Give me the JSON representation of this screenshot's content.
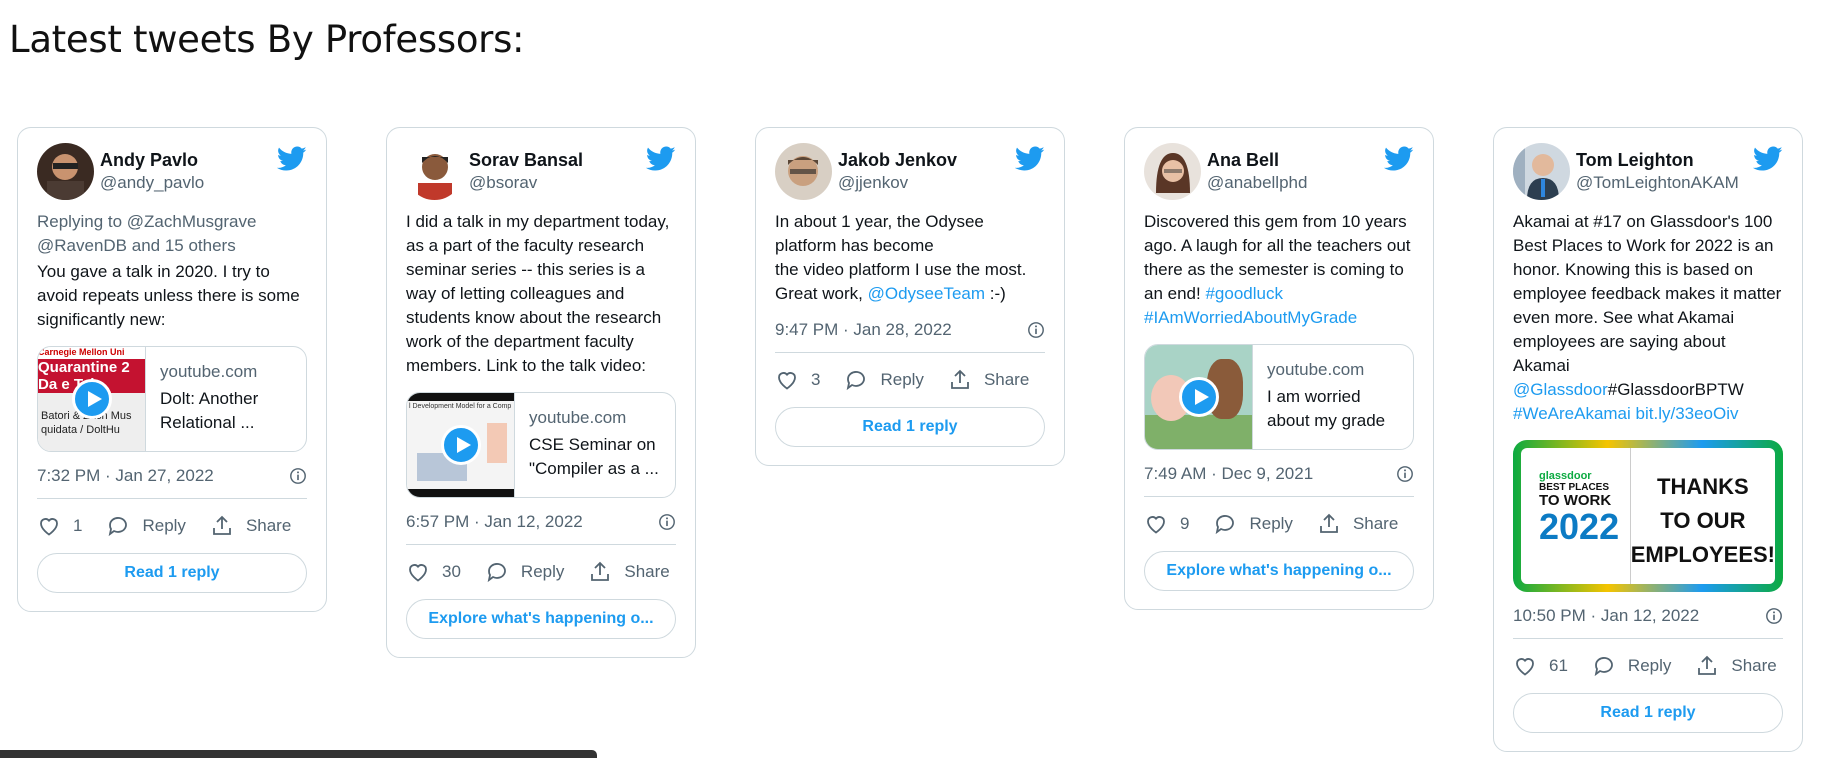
{
  "page": {
    "title": "Latest tweets By Professors:"
  },
  "tweets": [
    {
      "name": "Andy Pavlo",
      "handle": "@andy_pavlo",
      "reply_to": "Replying to @ZachMusgrave\n@RavenDB and 15 others",
      "text": "You gave a talk in 2020. I try to avoid repeats unless there is some significantly new:",
      "card": {
        "domain": "youtube.com",
        "title": "Dolt: Another\nRelational ...",
        "thumb_text": [
          "Carnegie Mellon Uni",
          "Quarantine 2",
          "Da  e Tal",
          "Batori & Zach Mus",
          "quidata / DoltHu"
        ]
      },
      "timestamp": "7:32 PM · Jan 27, 2022",
      "likes": "1",
      "reply_label": "Reply",
      "share_label": "Share",
      "button": "Read 1 reply"
    },
    {
      "name": "Sorav Bansal",
      "handle": "@bsorav",
      "text": "I did a talk in my department today, as a part of the faculty research seminar series -- this series is a way of letting colleagues and students know about the research work of the department faculty members.  Link to the talk video:",
      "card": {
        "domain": "youtube.com",
        "title": "CSE Seminar on\n\"Compiler as a ...",
        "thumb_text": [
          "l Development Model for a Comp"
        ]
      },
      "timestamp": "6:57 PM · Jan 12, 2022",
      "likes": "30",
      "reply_label": "Reply",
      "share_label": "Share",
      "button": "Explore what's happening o..."
    },
    {
      "name": "Jakob Jenkov",
      "handle": "@jjenkov",
      "text_before": "In about 1 year, the Odysee platform has become\nthe video platform I use the most. Great work, ",
      "mention": "@OdyseeTeam",
      "text_after": " :-)",
      "timestamp": "9:47 PM · Jan 28, 2022",
      "likes": "3",
      "reply_label": "Reply",
      "share_label": "Share",
      "button": "Read 1 reply"
    },
    {
      "name": "Ana Bell",
      "handle": "@anabellphd",
      "text_before": "Discovered this gem from 10 years ago. A laugh for all the teachers out there as the semester is coming to an end! ",
      "hashtag1": "#goodluck",
      "hashtag2": "#IAmWorriedAboutMyGrade",
      "card": {
        "domain": "youtube.com",
        "title": "I am worried\nabout my grade"
      },
      "timestamp": "7:49 AM · Dec 9, 2021",
      "likes": "9",
      "reply_label": "Reply",
      "share_label": "Share",
      "button": "Explore what's happening o..."
    },
    {
      "name": "Tom Leighton",
      "handle": "@TomLeightonAKAM",
      "text_before": "Akamai at #17 on Glassdoor's 100 Best Places to Work for 2022 is an honor. Knowing this is based on employee feedback makes it matter even more. See what Akamai employees are saying about Akamai\n",
      "mention": "@Glassdoor",
      "mid_text": "#GlassdoorBPTW",
      "link2": "#WeAreAkamai bit.ly/33eoOiv",
      "image": {
        "brand": "glassdoor",
        "line1": "BEST PLACES",
        "line2": "TO WORK",
        "year": "2022",
        "thanks": [
          "THANKS",
          "TO OUR",
          "EMPLOYEES!"
        ]
      },
      "timestamp": "10:50 PM · Jan 12, 2022",
      "likes": "61",
      "reply_label": "Reply",
      "share_label": "Share",
      "button": "Read 1 reply"
    }
  ],
  "colors": {
    "accent": "#1d9bf0",
    "border": "#cfd9de",
    "muted": "#536471",
    "text": "#0f1419"
  },
  "icons": [
    "twitter-bird-icon",
    "info-icon",
    "heart-icon",
    "reply-icon",
    "share-icon",
    "play-icon"
  ]
}
